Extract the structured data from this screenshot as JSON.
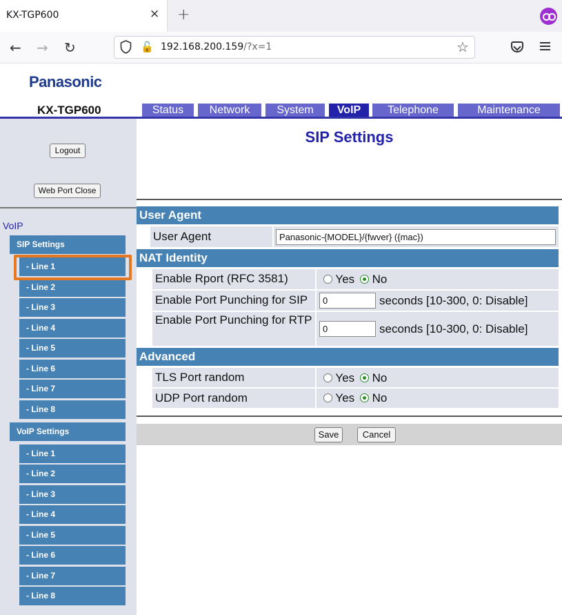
{
  "browser": {
    "tab_title": "KX-TGP600",
    "url_host": "192.168.200.159",
    "url_path": "/?x=1"
  },
  "header": {
    "brand": "Panasonic",
    "model": "KX-TGP600",
    "tabs": [
      {
        "label": "Status"
      },
      {
        "label": "Network"
      },
      {
        "label": "System"
      },
      {
        "label": "VoIP",
        "active": true
      },
      {
        "label": "Telephone"
      },
      {
        "label": "Maintenance"
      }
    ]
  },
  "sidebar": {
    "logout": "Logout",
    "web_port_close": "Web Port Close",
    "section": "VoIP",
    "sip_settings": "SIP Settings",
    "sip_lines": [
      "- Line 1",
      "- Line 2",
      "- Line 3",
      "- Line 4",
      "- Line 5",
      "- Line 6",
      "- Line 7",
      "- Line 8"
    ],
    "voip_settings": "VoIP Settings",
    "voip_lines": [
      "- Line 1",
      "- Line 2",
      "- Line 3",
      "- Line 4",
      "- Line 5",
      "- Line 6",
      "- Line 7",
      "- Line 8"
    ],
    "highlighted_item": "- Line 1"
  },
  "main": {
    "title": "SIP Settings",
    "user_agent": {
      "heading": "User Agent",
      "label": "User Agent",
      "value": "Panasonic-{MODEL}/{fwver} ({mac})"
    },
    "nat": {
      "heading": "NAT Identity",
      "rport_label": "Enable Rport (RFC 3581)",
      "sip_punch_label": "Enable Port Punching for SIP",
      "sip_punch_value": "0",
      "rtp_punch_label": "Enable Port Punching for RTP",
      "rtp_punch_value": "0",
      "unit": "seconds [10-300, 0: Disable]"
    },
    "advanced": {
      "heading": "Advanced",
      "tls_label": "TLS Port random",
      "udp_label": "UDP Port random"
    },
    "radio": {
      "yes": "Yes",
      "no": "No"
    },
    "save": "Save",
    "cancel": "Cancel"
  },
  "colors": {
    "nav_tab": "#6666cc",
    "nav_tab_active": "#2222aa",
    "section_header": "#4682b4",
    "highlight": "#e87722"
  }
}
